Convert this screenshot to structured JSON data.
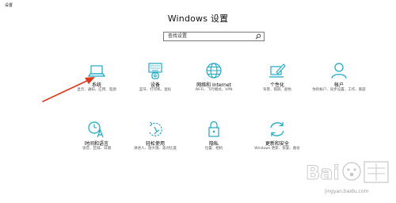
{
  "window": {
    "app_title": "设置",
    "page_title": "Windows 设置"
  },
  "search": {
    "placeholder": "查找设置"
  },
  "categories": [
    {
      "label": "系统",
      "desc": "显示、通知、应用、电源",
      "icon": "laptop-icon"
    },
    {
      "label": "设备",
      "desc": "蓝牙、打印机、鼠标",
      "icon": "keyboard-devices-icon"
    },
    {
      "label": "网络和 Internet",
      "desc": "Wi-Fi、飞行模式、VPN",
      "icon": "globe-icon"
    },
    {
      "label": "个性化",
      "desc": "背景、锁屏、颜色",
      "icon": "pen-tablet-icon"
    },
    {
      "label": "帐户",
      "desc": "你的帐户、同步设置、工作、家庭",
      "icon": "person-icon"
    },
    {
      "label": "时间和语言",
      "desc": "语音、区域、日期",
      "icon": "time-language-icon"
    },
    {
      "label": "轻松使用",
      "desc": "讲述人、放大镜、高对比度",
      "icon": "ease-of-access-icon"
    },
    {
      "label": "隐私",
      "desc": "位置、相机",
      "icon": "lock-icon"
    },
    {
      "label": "更新和安全",
      "desc": "Windows 更新、恢复、备份",
      "icon": "update-sync-icon"
    }
  ],
  "colors": {
    "accent": "#1aa8c4",
    "arrow": "#e0361a"
  },
  "watermark": {
    "url": "jingyan.baidu.com"
  }
}
